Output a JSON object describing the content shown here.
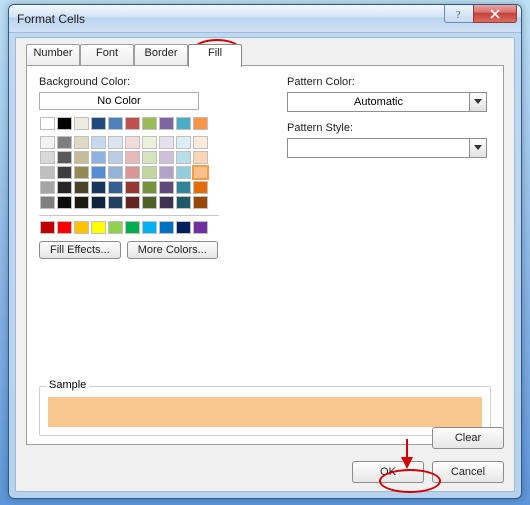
{
  "titlebar": {
    "title": "Format Cells"
  },
  "tabs": {
    "number": "Number",
    "font": "Font",
    "border": "Border",
    "fill": "Fill"
  },
  "fill": {
    "bgcolor_label": "Background Color:",
    "nocolor": "No Color",
    "fill_effects": "Fill Effects...",
    "more_colors": "More Colors...",
    "theme_rows": [
      [
        "#ffffff",
        "#000000",
        "#eeece1",
        "#1f497d",
        "#4f81bd",
        "#c0504d",
        "#9bbb59",
        "#8064a2",
        "#4bacc6",
        "#f79646"
      ],
      [
        "#f2f2f2",
        "#7f7f7f",
        "#ddd9c3",
        "#c6d9f0",
        "#dbe5f1",
        "#f2dcdb",
        "#ebf1dd",
        "#e5e0ec",
        "#dbeef3",
        "#fdeada"
      ],
      [
        "#d8d8d8",
        "#595959",
        "#c4bd97",
        "#8db3e2",
        "#b8cce4",
        "#e5b9b7",
        "#d7e3bc",
        "#ccc1d9",
        "#b7dde8",
        "#fbd5b5"
      ],
      [
        "#bfbfbf",
        "#3f3f3f",
        "#938953",
        "#548dd4",
        "#95b3d7",
        "#d99694",
        "#c3d69b",
        "#b2a2c7",
        "#92cddc",
        "#fac08f"
      ],
      [
        "#a5a5a5",
        "#262626",
        "#494429",
        "#17365d",
        "#366092",
        "#953734",
        "#76923c",
        "#5f497a",
        "#31859b",
        "#e36c09"
      ],
      [
        "#7f7f7f",
        "#0c0c0c",
        "#1d1b10",
        "#0f243e",
        "#244061",
        "#632423",
        "#4f6128",
        "#3f3151",
        "#205867",
        "#974806"
      ]
    ],
    "standard_row": [
      "#c00000",
      "#ff0000",
      "#ffc000",
      "#ffff00",
      "#92d050",
      "#00b050",
      "#00b0f0",
      "#0070c0",
      "#002060",
      "#7030a0"
    ],
    "selected_color": "#fac08f"
  },
  "pattern": {
    "color_label": "Pattern Color:",
    "color_value": "Automatic",
    "style_label": "Pattern Style:",
    "style_value": ""
  },
  "sample": {
    "legend": "Sample",
    "color": "#f8c690"
  },
  "buttons": {
    "clear": "Clear",
    "ok": "OK",
    "cancel": "Cancel"
  }
}
